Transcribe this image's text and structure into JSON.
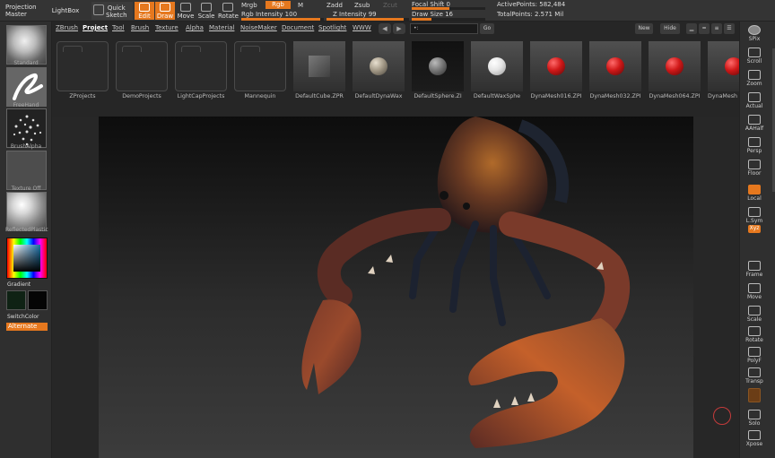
{
  "topbar": {
    "projection_master": [
      "Projection",
      "Master"
    ],
    "lightbox": "LightBox",
    "quick_sketch": [
      "Quick",
      "Sketch"
    ],
    "tools": [
      {
        "label": "Edit",
        "icon": "edit-icon",
        "active": true
      },
      {
        "label": "Draw",
        "icon": "draw-icon",
        "active": true
      },
      {
        "label": "Move",
        "icon": "move-icon",
        "active": false
      },
      {
        "label": "Scale",
        "icon": "scale-icon",
        "active": false
      },
      {
        "label": "Rotate",
        "icon": "rotate-icon",
        "active": false
      }
    ],
    "mrgb": "Mrgb",
    "rgb": "Rgb",
    "m": "M",
    "rgb_intensity": "Rgb Intensity 100",
    "zadd": "Zadd",
    "zsub": "Zsub",
    "zcut": "Zcut",
    "z_intensity": "Z Intensity 99",
    "focal_shift": "Focal Shift 0",
    "draw_size": "Draw Size 16",
    "active_points": "ActivePoints: 582,484",
    "total_points": "TotalPoints: 2.571 Mil"
  },
  "left_shelf": {
    "slots": [
      {
        "label": "Standard",
        "icon": "standard-brush-icon"
      },
      {
        "label": "FreeHand",
        "icon": "freehand-stroke-icon"
      },
      {
        "label": "BrushAlpha",
        "icon": "brush-alpha-icon"
      },
      {
        "label": "Texture Off",
        "icon": "texture-icon"
      },
      {
        "label": "ReflectedPlastic",
        "icon": "material-icon"
      }
    ],
    "gradient": "Gradient",
    "switch_color": "SwitchColor",
    "alternate": "Alternate"
  },
  "lightbox": {
    "tabs": [
      "ZBrush",
      "Project",
      "Tool",
      "Brush",
      "Texture",
      "Alpha",
      "Material",
      "NoiseMaker",
      "Document",
      "Spotlight",
      "WWW"
    ],
    "active_tab": "Project",
    "path": "•:",
    "go": "Go",
    "new": "New",
    "hide": "Hide",
    "items": [
      {
        "name": "ZProjects",
        "type": "folder"
      },
      {
        "name": "DemoProjects",
        "type": "folder"
      },
      {
        "name": "LightCapProjects",
        "type": "folder"
      },
      {
        "name": "Mannequin",
        "type": "folder"
      },
      {
        "name": "DefaultCube.ZPR",
        "type": "cube"
      },
      {
        "name": "DefaultDynaWax",
        "type": "sphere",
        "color": "#a49a88"
      },
      {
        "name": "DefaultSphere.ZI",
        "type": "sphere",
        "color": "#7a7a7a",
        "black": true
      },
      {
        "name": "DefaultWaxSphe",
        "type": "sphere",
        "color": "#eeeeee"
      },
      {
        "name": "DynaMesh016.ZPI",
        "type": "sphere",
        "color": "#d01818"
      },
      {
        "name": "DynaMesh032.ZPI",
        "type": "sphere",
        "color": "#d01818"
      },
      {
        "name": "DynaMesh064.ZPI",
        "type": "sphere",
        "color": "#d01818"
      },
      {
        "name": "DynaMesh",
        "type": "sphere",
        "color": "#d01818"
      }
    ]
  },
  "right_shelf": [
    {
      "label": "SPix",
      "icon": "spix-icon"
    },
    {
      "label": "Scroll",
      "icon": "scroll-icon"
    },
    {
      "label": "Zoom",
      "icon": "zoom-icon"
    },
    {
      "label": "Actual",
      "icon": "actual-icon"
    },
    {
      "label": "AAHalf",
      "icon": "aahalf-icon"
    },
    {
      "label": "Persp",
      "icon": "persp-icon"
    },
    {
      "label": "Floor",
      "icon": "floor-icon"
    },
    {
      "label": "Local",
      "icon": "local-icon",
      "orange": true
    },
    {
      "label": "L.Sym",
      "icon": "lsym-icon"
    },
    {
      "label": "Xyz",
      "icon": "xyz-icon",
      "orange": true
    },
    {
      "label": "Frame",
      "icon": "frame-icon"
    },
    {
      "label": "Move",
      "icon": "move-view-icon"
    },
    {
      "label": "Scale",
      "icon": "scale-view-icon"
    },
    {
      "label": "Rotate",
      "icon": "rotate-view-icon"
    },
    {
      "label": "PolyF",
      "icon": "polyframe-icon"
    },
    {
      "label": "Transp",
      "icon": "transp-icon"
    },
    {
      "label": "",
      "icon": "ghost-icon",
      "brown": true
    },
    {
      "label": "Solo",
      "icon": "solo-icon"
    },
    {
      "label": "Xpose",
      "icon": "xpose-icon"
    }
  ],
  "colors": {
    "accent": "#e6781e",
    "canvas_top": "#0d0d0d",
    "canvas_bottom": "#3c3c3c"
  }
}
